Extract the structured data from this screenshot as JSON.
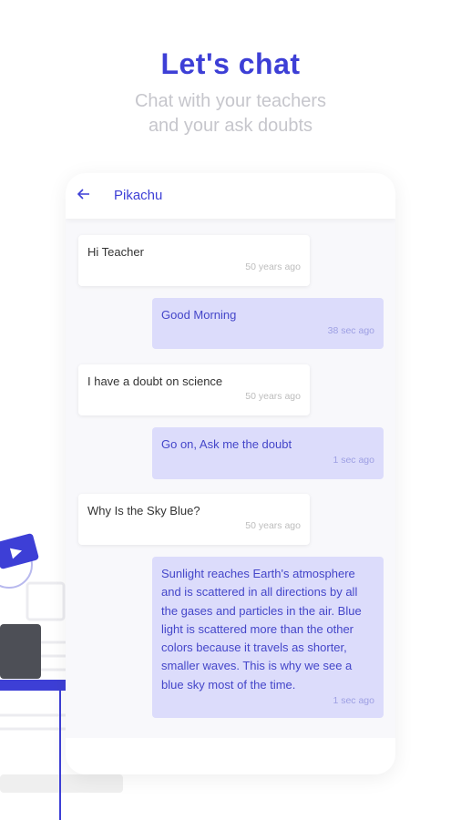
{
  "header": {
    "title": "Let's chat",
    "subtitle_line1": "Chat with your teachers",
    "subtitle_line2": "and your ask doubts"
  },
  "chat": {
    "contact_name": "Pikachu",
    "back_icon": "arrow-left-icon",
    "messages": [
      {
        "direction": "incoming",
        "text": "Hi Teacher",
        "time": "50 years ago"
      },
      {
        "direction": "outgoing",
        "text": "Good Morning",
        "time": "38 sec ago"
      },
      {
        "direction": "incoming",
        "text": "I have a doubt on science",
        "time": "50 years ago"
      },
      {
        "direction": "outgoing",
        "text": "Go on, Ask me the doubt",
        "time": "1 sec ago"
      },
      {
        "direction": "incoming",
        "text": "Why Is the Sky Blue?",
        "time": "50 years ago"
      },
      {
        "direction": "outgoing",
        "text": "Sunlight reaches Earth's atmosphere and is scattered in all directions by all the gases and particles in the air. Blue light is scattered more than the other colors because it travels as shorter, smaller waves. This is why we see a blue sky most of the time.",
        "time": "1 sec ago"
      }
    ]
  },
  "colors": {
    "accent": "#3d3fd6",
    "outgoing_bubble": "#dcdcfb",
    "subtitle": "#c6c6cc"
  }
}
